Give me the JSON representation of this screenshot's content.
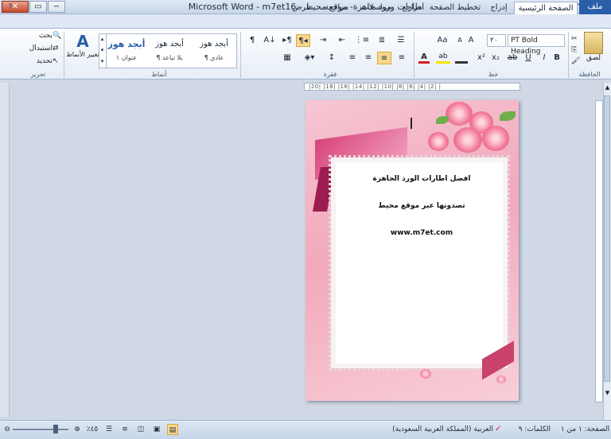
{
  "window": {
    "title": "Microsoft Word - m7et16 - اطارات ورود جاهزة- موقع محيط",
    "close": "✕",
    "restore": "▭",
    "minimize": "−",
    "qat": [
      "W",
      "💾",
      "↶",
      "↷",
      "▾"
    ]
  },
  "tabs": {
    "file": "ملف",
    "items": [
      "الصفحة الرئيسية",
      "إدراج",
      "تخطيط الصفحة",
      "مراجع",
      "مراسلات",
      "مراجعة",
      "عرض"
    ],
    "help": "?"
  },
  "ribbon": {
    "clipboard": {
      "label": "الحافظة",
      "paste": "لصق"
    },
    "font": {
      "label": "خط",
      "font_name": "PT Bold Heading",
      "font_size": "٢٠",
      "buttons": [
        "B",
        "I",
        "U",
        "ab",
        "x₂",
        "x²",
        "Aa",
        "A",
        "A"
      ]
    },
    "paragraph": {
      "label": "فقرة",
      "buttons": [
        "¶",
        "A↓",
        "⇤",
        "⇥",
        "≡",
        "≡",
        "≡",
        "≡",
        "↕",
        "▦"
      ]
    },
    "styles": {
      "label": "أنماط",
      "items": [
        {
          "sample": "أبجد هوز",
          "name": "¶ عادي"
        },
        {
          "sample": "أبجد هوز",
          "name": "¶ بلا تباعد"
        },
        {
          "sample": "أبجد هوز",
          "name": "عنوان ١"
        }
      ],
      "change": "تغيير الأنماط"
    },
    "editing": {
      "label": "تحرير",
      "find": "بحث",
      "replace": "استبدال",
      "select": "تحديد"
    }
  },
  "ruler": {
    "marks": "|20| |18| |16| |14| |12| |10| |8| |6| |4| |2| |"
  },
  "page": {
    "line1": "افضل اطارات الورد الجاهزة",
    "line2": "تصدونها عبر موقع محيط",
    "line3": "www.m7et.com"
  },
  "status": {
    "page": "الصفحة: ١ من ١",
    "words": "الكلمات: ٩",
    "language": "العربية (المملكة العربية السعودية)",
    "zoom": "٪٤٥"
  }
}
